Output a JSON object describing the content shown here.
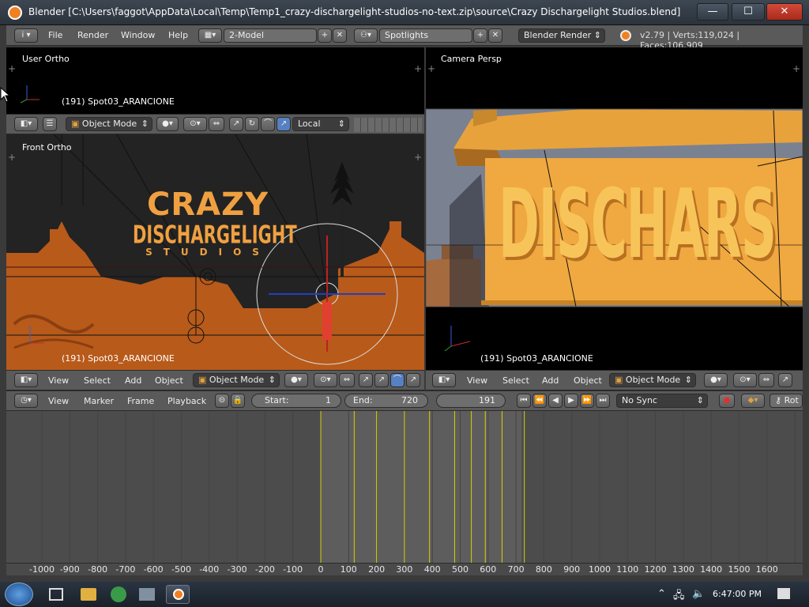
{
  "window": {
    "title": "Blender [C:\\Users\\faggot\\AppData\\Local\\Temp\\Temp1_crazy-dischargelight-studios-no-text.zip\\source\\Crazy Dischargelight Studios.blend]",
    "min": "—",
    "max": "☐",
    "close": "✕"
  },
  "menubar": {
    "info": "i",
    "file": "File",
    "render": "Render",
    "window": "Window",
    "help": "Help",
    "layout": "2-Model",
    "scene": "Spotlights",
    "engine": "Blender Render",
    "stats": "v2.79 | Verts:119,024 | Faces:106,909"
  },
  "viewports": {
    "top_left": {
      "label": "User Ortho",
      "object": "(191) Spot03_ARANCIONE"
    },
    "bottom_left": {
      "label": "Front Ortho",
      "object": "(191) Spot03_ARANCIONE"
    },
    "right": {
      "label": "Camera Persp",
      "object": "(191) Spot03_ARANCIONE"
    }
  },
  "toolbar_top": {
    "mode": "Object Mode",
    "orientation": "Local"
  },
  "header_left": {
    "view": "View",
    "select": "Select",
    "add": "Add",
    "object": "Object",
    "mode": "Object Mode"
  },
  "header_right": {
    "view": "View",
    "select": "Select",
    "add": "Add",
    "object": "Object",
    "mode": "Object Mode"
  },
  "timeline_header": {
    "view": "View",
    "marker": "Marker",
    "frame": "Frame",
    "playback": "Playback",
    "start_label": "Start:",
    "start_value": "1",
    "end_label": "End:",
    "end_value": "720",
    "current_frame": "191",
    "sync": "No Sync",
    "rot": "Rot"
  },
  "timeline": {
    "frame_range": [
      0,
      720
    ],
    "current_frame": 191,
    "keyframes": [
      0,
      120,
      200,
      300,
      390,
      480,
      540,
      590,
      650,
      730
    ],
    "ticks": [
      "-1000",
      "-900",
      "-800",
      "-700",
      "-600",
      "-500",
      "-400",
      "-300",
      "-200",
      "-100",
      "0",
      "100",
      "200",
      "300",
      "400",
      "500",
      "600",
      "700",
      "800",
      "900",
      "1000",
      "1100",
      "1200",
      "1300",
      "1400",
      "1500",
      "1600"
    ]
  },
  "scene_text": {
    "crazy": "CRAZY",
    "dischargelight": "DISCHARGELIGHT",
    "studios": "STUDIOS",
    "camera_text": "DISCHARS"
  },
  "taskbar": {
    "clock": "6:47:00 PM"
  },
  "colors": {
    "accent_orange": "#f0a040",
    "scene_orange": "#b85a1a",
    "timeline_bg": "#5d5d5d",
    "keyframe_yellow": "#d8d000"
  }
}
